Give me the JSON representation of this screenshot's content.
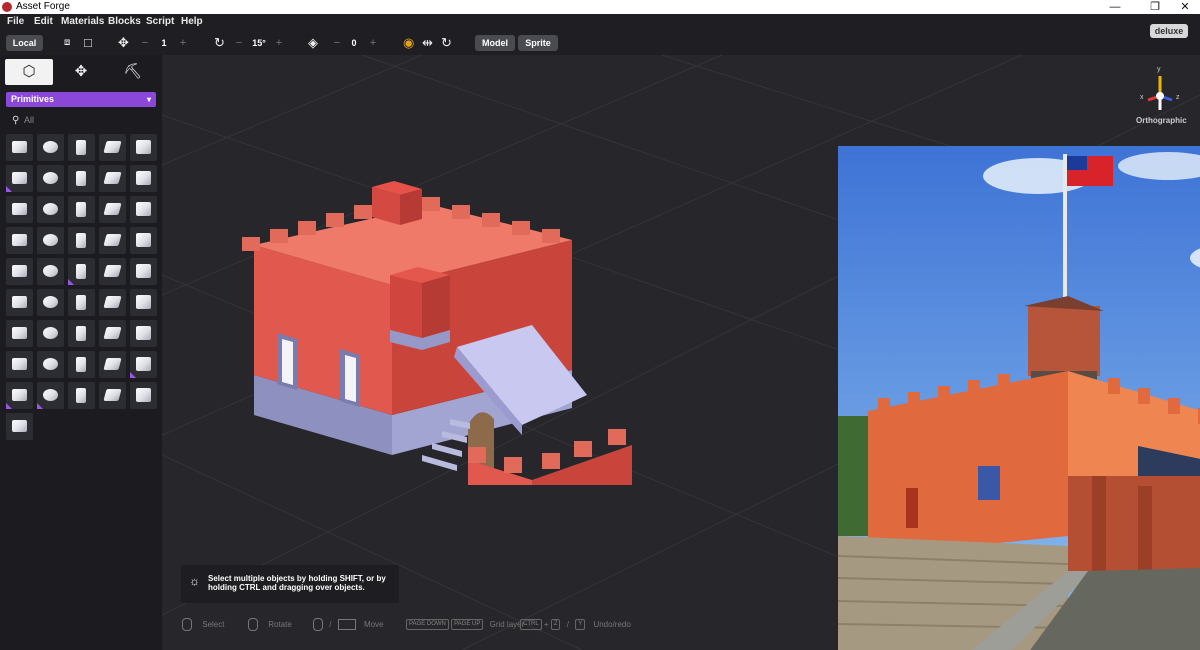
{
  "window": {
    "title": "Asset Forge",
    "minimize": "—",
    "maximize": "❐",
    "close": "✕"
  },
  "menu": [
    "File",
    "Edit",
    "Materials",
    "Blocks",
    "Script",
    "Help"
  ],
  "toolbar": {
    "space_label": "Local",
    "move_minus": "−",
    "move_value": "1",
    "move_plus": "+",
    "rotate_minus": "−",
    "rotate_value": "15°",
    "rotate_plus": "+",
    "layer_minus": "−",
    "layer_value": "0",
    "layer_plus": "+",
    "model_label": "Model",
    "sprite_label": "Sprite"
  },
  "badge": {
    "label": "deluxe"
  },
  "sidebar": {
    "tabs": [
      {
        "name": "blocks",
        "icon": "cube-icon",
        "selected": true
      },
      {
        "name": "transform",
        "icon": "move-arrows-icon",
        "selected": false
      },
      {
        "name": "paint",
        "icon": "paint-roller-icon",
        "selected": false
      }
    ],
    "category_label": "Primitives",
    "search_placeholder": "All",
    "primitive_count": 46,
    "marked_cells": [
      5,
      22,
      39,
      40,
      41
    ]
  },
  "gizmo": {
    "view_label": "Orthographic",
    "axis_x": "x",
    "axis_y": "y",
    "axis_z": "z",
    "colors": {
      "x": "#e53935",
      "y": "#f0b400",
      "z": "#3a5ddd"
    }
  },
  "tip": {
    "text": "Select multiple objects by holding SHIFT, or by holding CTRL and dragging over objects."
  },
  "hints": {
    "select": "Select",
    "rotate": "Rotate",
    "slash": "/",
    "move": "Move",
    "page_down_key": "PAGE DOWN",
    "page_up_key": "PAGE UP",
    "grid_layer": "Grid layer",
    "ctrl_key": "CTRL",
    "plus": "+",
    "z_key": "Z",
    "y_key": "Y",
    "undo_redo": "Undo/redo"
  },
  "colors": {
    "accent": "#8b48d8",
    "castle_red": "#e0584e",
    "castle_base": "#9a9cc8"
  }
}
